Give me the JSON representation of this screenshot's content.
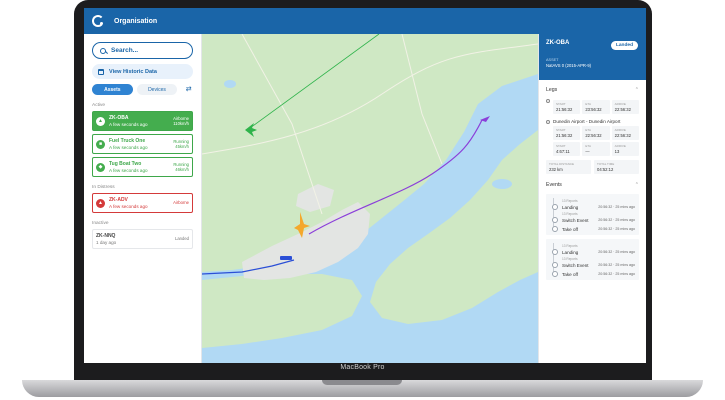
{
  "device": {
    "brand": "MacBook Pro"
  },
  "header": {
    "title": "Organisation"
  },
  "sidebar": {
    "search_placeholder": "Search...",
    "history_label": "View Historic Data",
    "tabs": [
      {
        "label": "Assets"
      },
      {
        "label": "Devices"
      }
    ],
    "sections": {
      "active": "Active",
      "distress": "In Distress",
      "inactive": "Inactive"
    },
    "assets": [
      {
        "name": "ZK-OBA",
        "sub": "A few seconds ago",
        "status_1": "Airborne",
        "status_2": "110km/h"
      },
      {
        "name": "Fuel Truck One",
        "sub": "A few seconds ago",
        "status_1": "Running",
        "status_2": "45km/h"
      },
      {
        "name": "Tug Boat Two",
        "sub": "A few seconds ago",
        "status_1": "Running",
        "status_2": "46km/h"
      },
      {
        "name": "ZK-ADV",
        "sub": "A few seconds ago",
        "status_1": "Airborne",
        "status_2": ""
      },
      {
        "name": "ZK-NNQ",
        "sub": "1 day ago",
        "status_1": "Landed",
        "status_2": ""
      }
    ]
  },
  "panel": {
    "callsign": "ZK-OBA",
    "badge": "Landed",
    "sub_label": "ASSET",
    "sub_value": "NatAVS 0 (2015-APR-9)",
    "legs_title": "Legs",
    "legs": [
      {
        "title": "",
        "cells": [
          {
            "label": "START",
            "value": "21:56:32"
          },
          {
            "label": "ETA",
            "value": "23:56:32"
          },
          {
            "label": "ARRIVE",
            "value": "22:56:32"
          }
        ]
      },
      {
        "title": "Dunedin Airport - Dunedin Airport",
        "cells": [
          {
            "label": "START",
            "value": "21:56:32"
          },
          {
            "label": "ETA",
            "value": "22:56:32"
          },
          {
            "label": "ARRIVE",
            "value": "22:56:32"
          }
        ]
      },
      {
        "title": "",
        "cells": [
          {
            "label": "START",
            "value": "4:67:11"
          },
          {
            "label": "ETA",
            "value": "—"
          },
          {
            "label": "ARRIVE",
            "value": "13"
          }
        ]
      }
    ],
    "summary": [
      {
        "label": "TOTAL DISTANCE",
        "value": "232 km"
      },
      {
        "label": "TOTAL TIME",
        "value": "04:52:12"
      }
    ],
    "events_title": "Events",
    "event_groups": [
      {
        "events": [
          {
            "meta": "13 Reports",
            "name": "Landing",
            "time": "20:56:32 · 25 mins ago"
          },
          {
            "meta": "13 Reports",
            "name": "Switch Event",
            "time": "20:56:32 · 25 mins ago"
          },
          {
            "meta": "",
            "name": "Take off",
            "time": "20:56:32 · 25 mins ago"
          }
        ]
      },
      {
        "events": [
          {
            "meta": "13 Reports",
            "name": "Landing",
            "time": "20:56:32 · 25 mins ago"
          },
          {
            "meta": "13 Reports",
            "name": "Switch Event",
            "time": "20:56:32 · 25 mins ago"
          },
          {
            "meta": "",
            "name": "Take off",
            "time": "20:56:32 · 25 mins ago"
          }
        ]
      }
    ]
  },
  "colors": {
    "brand": "#1a65a8",
    "active": "#44ad4e",
    "alert": "#d43a3a",
    "water": "#b1d9f4",
    "land": "#cfe8c4"
  }
}
